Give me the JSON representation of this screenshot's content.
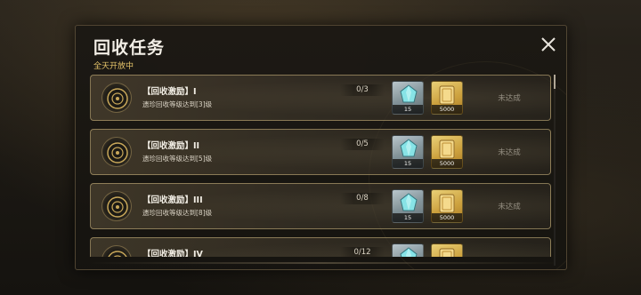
{
  "header": {
    "title": "回收任务",
    "subtitle": "全天开放中",
    "close_icon": "close-icon"
  },
  "colors": {
    "accent_gold": "#e6c46a",
    "row_border": "#d2b982",
    "status_gray": "#8f8a80"
  },
  "tasks": [
    {
      "title": "【回收激励】I",
      "desc": "遗珍回收等级达到[3]级",
      "progress": "0/3",
      "rewards": [
        {
          "icon": "crystal-icon",
          "count": "15"
        },
        {
          "icon": "gold-ticket-icon",
          "count": "5000"
        }
      ],
      "status": "未达成"
    },
    {
      "title": "【回收激励】II",
      "desc": "遗珍回收等级达到[5]级",
      "progress": "0/5",
      "rewards": [
        {
          "icon": "crystal-icon",
          "count": "15"
        },
        {
          "icon": "gold-ticket-icon",
          "count": "5000"
        }
      ],
      "status": "未达成"
    },
    {
      "title": "【回收激励】III",
      "desc": "遗珍回收等级达到[8]级",
      "progress": "0/8",
      "rewards": [
        {
          "icon": "crystal-icon",
          "count": "15"
        },
        {
          "icon": "gold-ticket-icon",
          "count": "5000"
        }
      ],
      "status": "未达成"
    },
    {
      "title": "【回收激励】IV",
      "desc": "",
      "progress": "0/12",
      "rewards": [
        {
          "icon": "crystal-icon",
          "count": ""
        },
        {
          "icon": "gold-ticket-icon",
          "count": ""
        }
      ],
      "status": ""
    }
  ]
}
